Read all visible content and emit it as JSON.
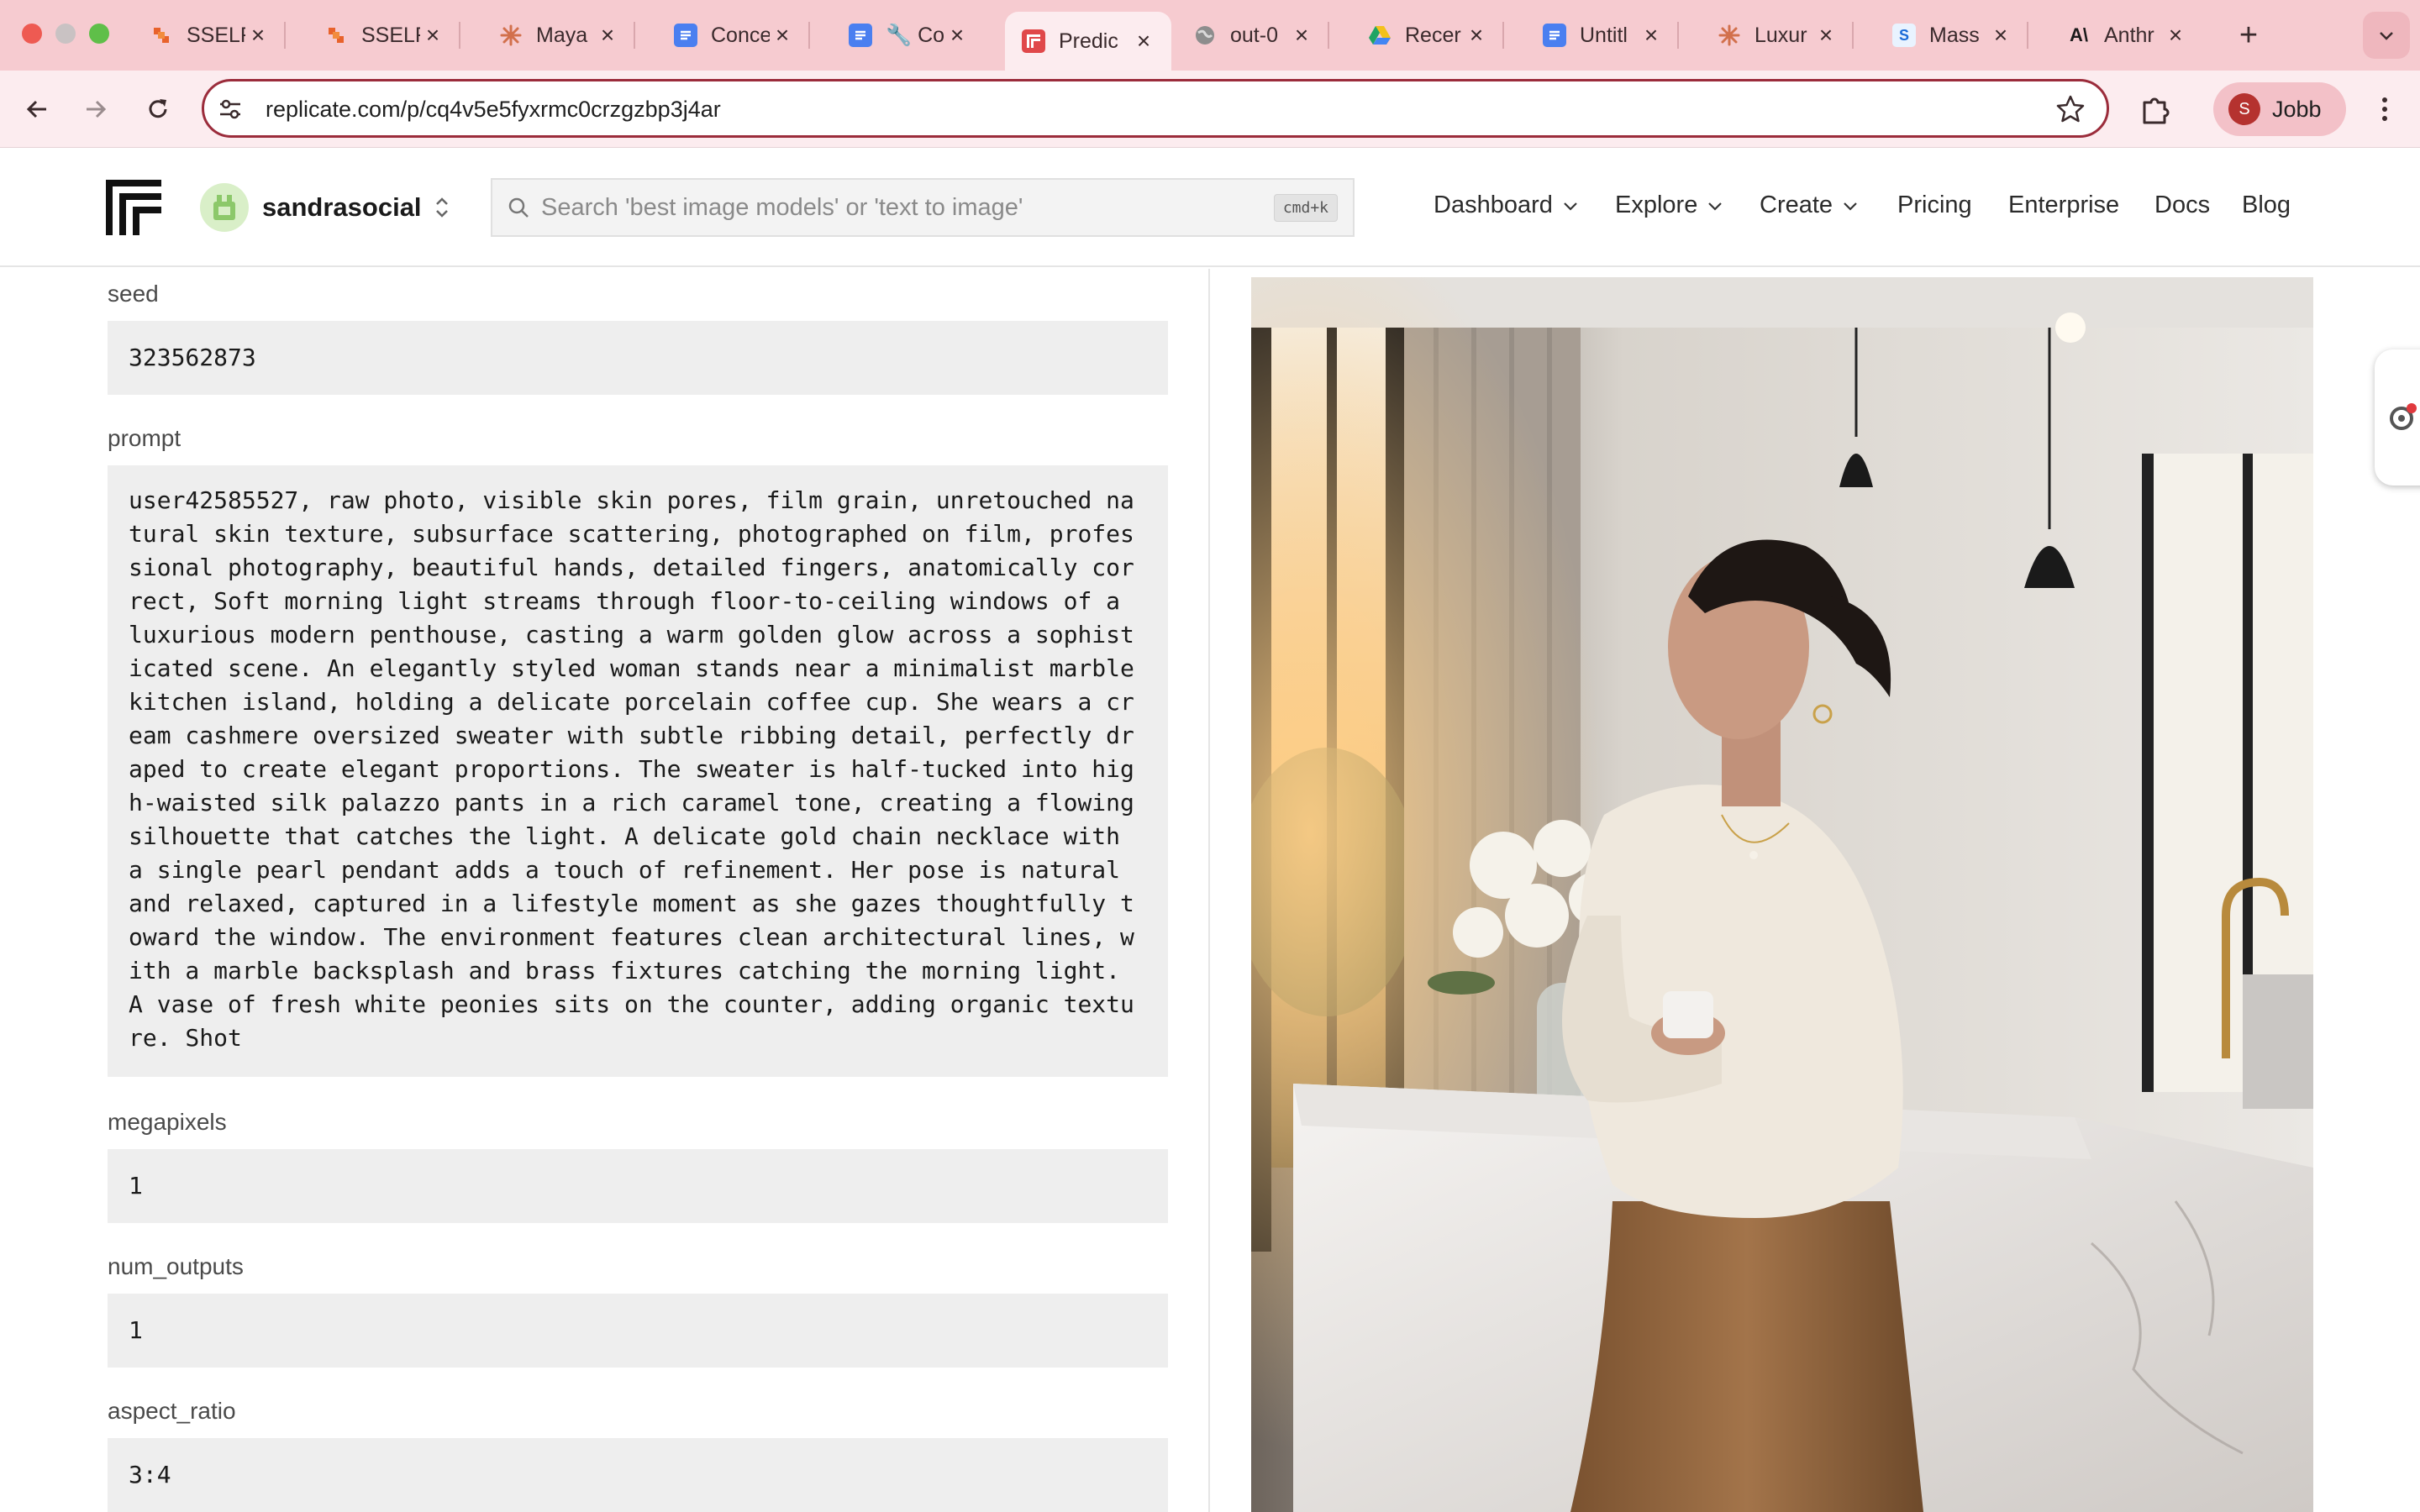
{
  "browser": {
    "tabs": [
      {
        "title": "SSELF",
        "icon": "replicate-orange-icon"
      },
      {
        "title": "SSELF",
        "icon": "replicate-orange-icon"
      },
      {
        "title": "Maya",
        "icon": "claude-icon"
      },
      {
        "title": "Conce",
        "icon": "google-docs-icon"
      },
      {
        "title": "Co",
        "icon": "google-docs-icon"
      },
      {
        "title": "Predic",
        "icon": "replicate-icon",
        "active": true
      },
      {
        "title": "out-0",
        "icon": "globe-icon"
      },
      {
        "title": "Recer",
        "icon": "google-drive-icon"
      },
      {
        "title": "Untitl",
        "icon": "google-docs-icon"
      },
      {
        "title": "Luxur",
        "icon": "claude-icon"
      },
      {
        "title": "Mass",
        "icon": "s-icon"
      },
      {
        "title": "Anthr",
        "icon": "anthropic-icon"
      }
    ],
    "url": "replicate.com/p/cq4v5e5fyxrmc0crzgzbp3j4ar",
    "profile_initial": "S",
    "profile_name": "Jobb"
  },
  "header": {
    "account_name": "sandrasocial",
    "search_placeholder": "Search 'best image models' or 'text to image'",
    "search_shortcut": "cmd+k",
    "nav": [
      {
        "label": "Dashboard",
        "dropdown": true
      },
      {
        "label": "Explore",
        "dropdown": true
      },
      {
        "label": "Create",
        "dropdown": true
      },
      {
        "label": "Pricing",
        "dropdown": false
      },
      {
        "label": "Enterprise",
        "dropdown": false
      },
      {
        "label": "Docs",
        "dropdown": false
      },
      {
        "label": "Blog",
        "dropdown": false
      }
    ]
  },
  "inputs": {
    "seed": {
      "label": "seed",
      "value": "323562873"
    },
    "prompt": {
      "label": "prompt",
      "value": "user42585527, raw photo, visible skin pores, film grain, unretouched natural skin texture, subsurface scattering, photographed on film, professional photography, beautiful hands, detailed fingers, anatomically correct, Soft morning light streams through floor-to-ceiling windows of a luxurious modern penthouse, casting a warm golden glow across a sophisticated scene. An elegantly styled woman stands near a minimalist marble kitchen island, holding a delicate porcelain coffee cup. She wears a cream cashmere oversized sweater with subtle ribbing detail, perfectly draped to create elegant proportions. The sweater is half-tucked into high-waisted silk palazzo pants in a rich caramel tone, creating a flowing silhouette that catches the light. A delicate gold chain necklace with a single pearl pendant adds a touch of refinement. Her pose is natural and relaxed, captured in a lifestyle moment as she gazes thoughtfully toward the window. The environment features clean architectural lines, with a marble backsplash and brass fixtures catching the morning light. A vase of fresh white peonies sits on the counter, adding organic texture. Shot"
    },
    "megapixels": {
      "label": "megapixels",
      "value": "1"
    },
    "num_outputs": {
      "label": "num_outputs",
      "value": "1"
    },
    "aspect_ratio": {
      "label": "aspect_ratio",
      "value": "3:4"
    }
  },
  "output": {
    "image_subject": "woman-in-cream-sweater-holding-coffee-cup-in-kitchen"
  },
  "colors": {
    "tabstrip": "#f6cbd0",
    "toolbar": "#fcecef",
    "omnibox_border": "#9b2c3b",
    "field_bg": "#eeeeee"
  }
}
